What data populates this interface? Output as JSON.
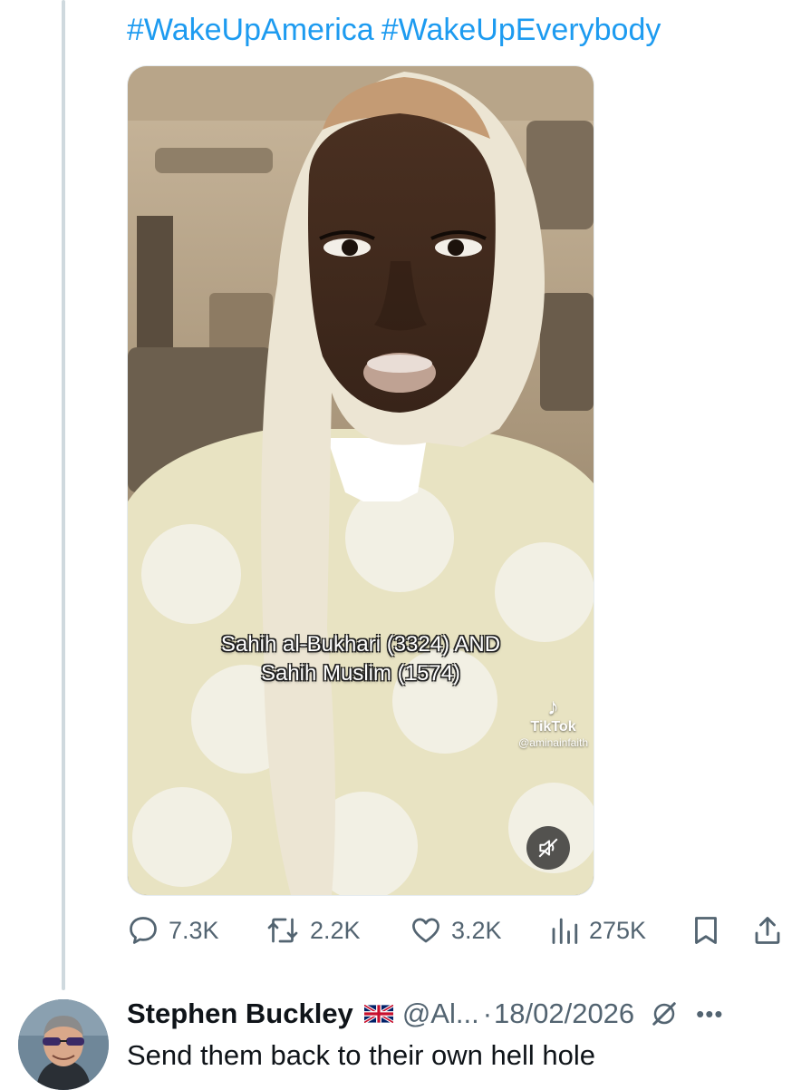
{
  "tweet": {
    "hashtags": [
      "#WakeUpAmerica",
      "#WakeUpEverybody"
    ],
    "media": {
      "caption_line1": "Sahih al-Bukhari (3324) AND",
      "caption_line2": "Sahih Muslim (1574)",
      "watermark_brand": "TikTok",
      "watermark_handle": "@aminainfaith",
      "watermark_icon": "tiktok-note-icon",
      "mute_icon": "speaker-muted-icon"
    },
    "actions": {
      "replies": "7.3K",
      "reposts": "2.2K",
      "likes": "3.2K",
      "views": "275K"
    }
  },
  "reply": {
    "author_name": "Stephen Buckley",
    "flag_icon": "uk-flag-icon",
    "handle": "@Al...",
    "separator": "·",
    "date": "18/02/2026",
    "text": "Send them back to their own hell hole"
  },
  "colors": {
    "link": "#1d9bf0",
    "muted": "#536471",
    "text": "#0f1419",
    "thread_line": "#cfd9de"
  }
}
